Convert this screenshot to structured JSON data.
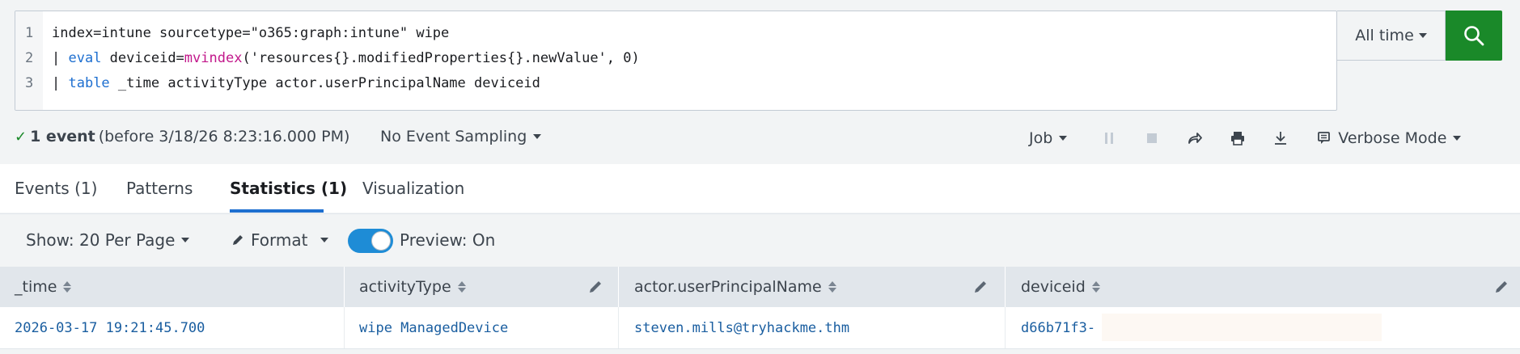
{
  "search": {
    "lines": [
      {
        "num": "1",
        "text": "index=intune sourcetype=\"o365:graph:intune\" wipe"
      },
      {
        "num": "2",
        "pipe": "| ",
        "cmd": "eval",
        "pre": " deviceid=",
        "fn": "mvindex",
        "rest": "('resources{}.modifiedProperties{}.newValue', 0)"
      },
      {
        "num": "3",
        "pipe": "| ",
        "cmd": "table",
        "rest": " _time activityType actor.userPrincipalName deviceid"
      }
    ],
    "time_range": "All time",
    "accent": "#1a8929"
  },
  "status": {
    "event_count": "1 event",
    "detail": "(before 3/18/26 8:23:16.000 PM)",
    "sampling": "No Event Sampling",
    "job": "Job",
    "mode": "Verbose Mode"
  },
  "tabs": [
    {
      "label": "Events (1)",
      "active": false
    },
    {
      "label": "Patterns",
      "active": false
    },
    {
      "label": "Statistics (1)",
      "active": true
    },
    {
      "label": "Visualization",
      "active": false
    }
  ],
  "toolbar": {
    "show": "Show: 20 Per Page",
    "format": "Format",
    "preview": "Preview: On",
    "preview_on": true
  },
  "table": {
    "columns": [
      "_time",
      "activityType",
      "actor.userPrincipalName",
      "deviceid"
    ],
    "rows": [
      [
        "2026-03-17 19:21:45.700",
        "wipe ManagedDevice",
        "steven.mills@tryhackme.thm",
        "d66b71f3-"
      ]
    ]
  },
  "icons": {
    "search": "search-icon",
    "check": "checkmark-icon",
    "pause": "pause-icon",
    "stop": "stop-icon",
    "share": "share-icon",
    "print": "print-icon",
    "export": "download-icon",
    "mode": "mode-icon",
    "edit": "pencil-icon"
  }
}
